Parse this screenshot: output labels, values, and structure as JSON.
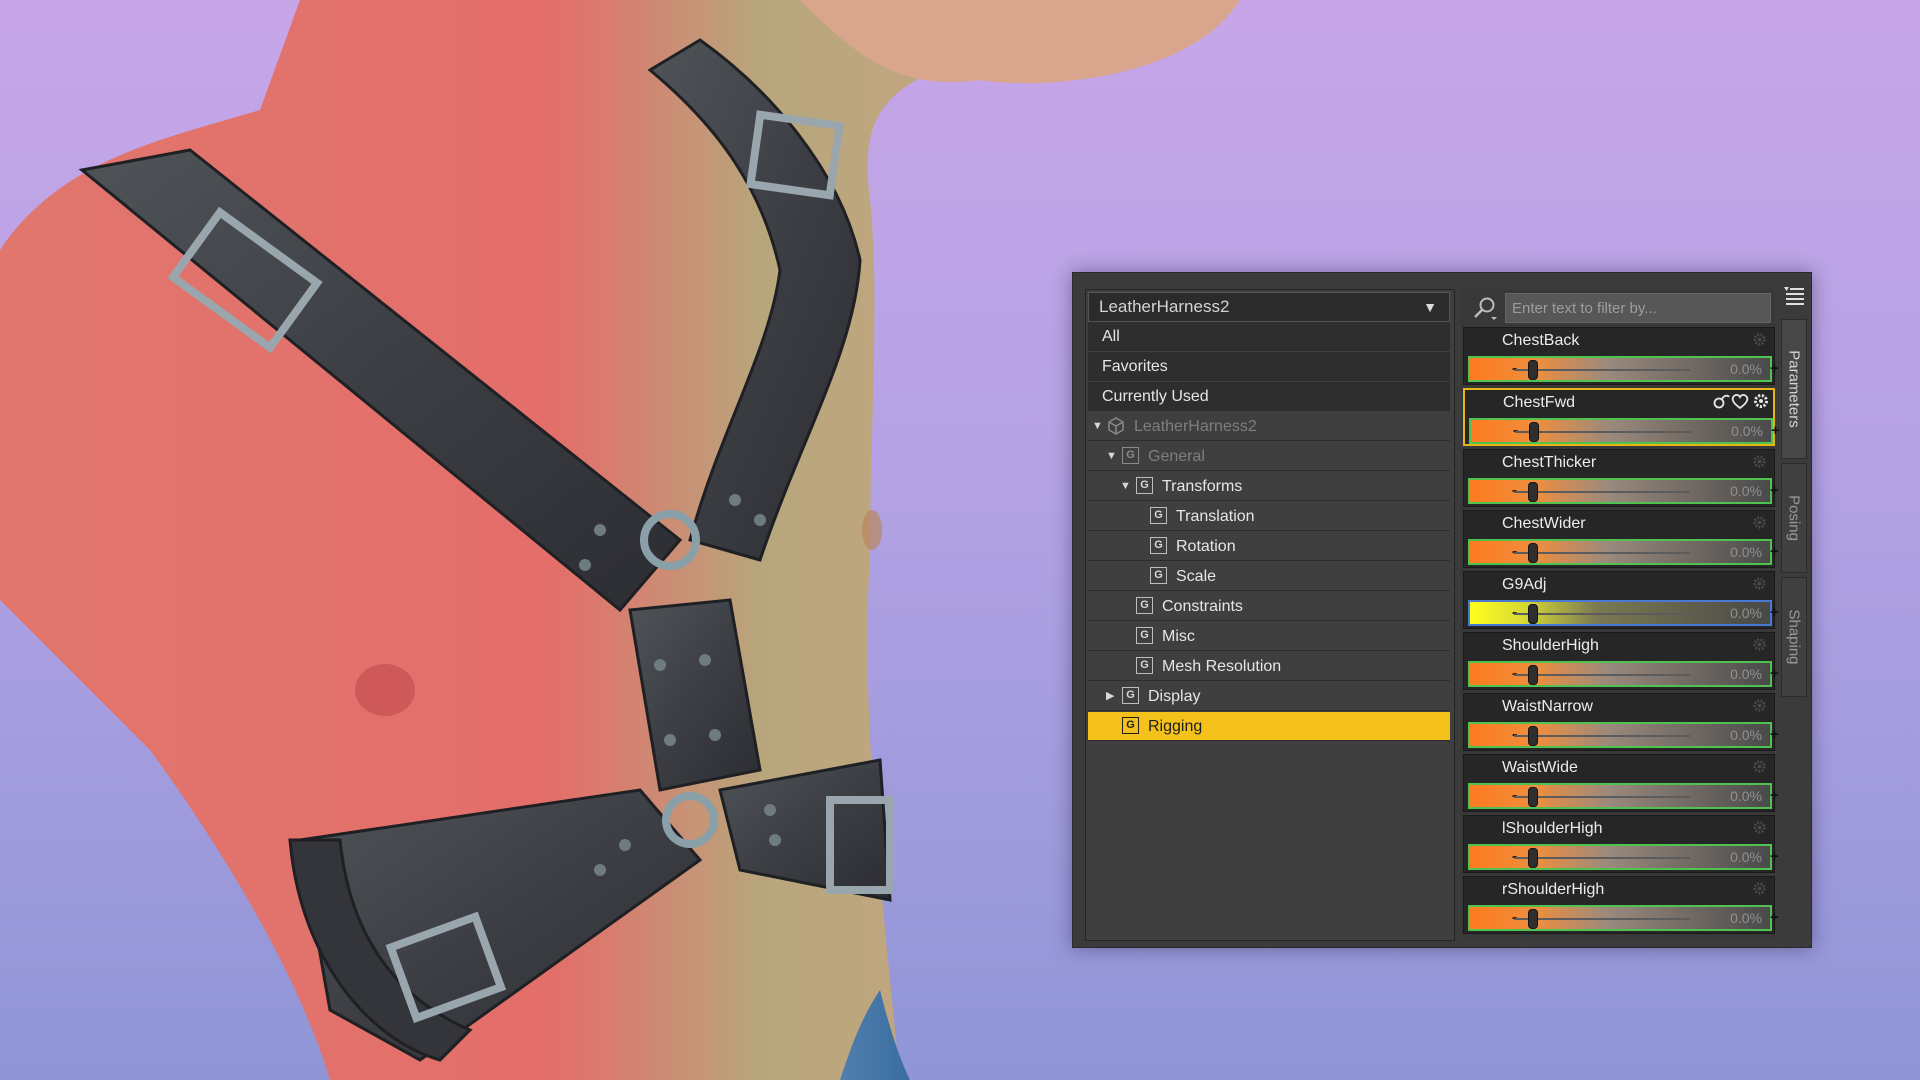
{
  "panel": {
    "node_selector": "LeatherHarness2",
    "filter_placeholder": "Enter text to filter by...",
    "tree": [
      {
        "label": "All"
      },
      {
        "label": "Favorites"
      },
      {
        "label": "Currently Used"
      },
      {
        "label": "LeatherHarness2",
        "icon": "figure-cube-icon"
      },
      {
        "label": "General"
      },
      {
        "label": "Transforms"
      },
      {
        "label": "Translation"
      },
      {
        "label": "Rotation"
      },
      {
        "label": "Scale"
      },
      {
        "label": "Constraints"
      },
      {
        "label": "Misc"
      },
      {
        "label": "Mesh Resolution"
      },
      {
        "label": "Display"
      },
      {
        "label": "Rigging",
        "selected": true
      }
    ],
    "group_icon_letter": "G",
    "parameters": [
      {
        "name": "ChestBack",
        "value": "0.0%"
      },
      {
        "name": "ChestFwd",
        "value": "0.0%"
      },
      {
        "name": "ChestThicker",
        "value": "0.0%"
      },
      {
        "name": "ChestWider",
        "value": "0.0%"
      },
      {
        "name": "G9Adj",
        "value": "0.0%"
      },
      {
        "name": "ShoulderHigh",
        "value": "0.0%"
      },
      {
        "name": "WaistNarrow",
        "value": "0.0%"
      },
      {
        "name": "WaistWide",
        "value": "0.0%"
      },
      {
        "name": "lShoulderHigh",
        "value": "0.0%"
      },
      {
        "name": "rShoulderHigh",
        "value": "0.0%"
      }
    ],
    "slider_minus": "-",
    "slider_plus": "+",
    "side_tabs": [
      "Parameters",
      "Posing",
      "Shaping"
    ],
    "colors": {
      "selection": "#f4c21b",
      "slider_orange": "#ff7b1f",
      "slider_yellow": "#ffff1c",
      "slider_border_green": "#4fc24f",
      "slider_border_blue": "#4a7ad6"
    }
  }
}
